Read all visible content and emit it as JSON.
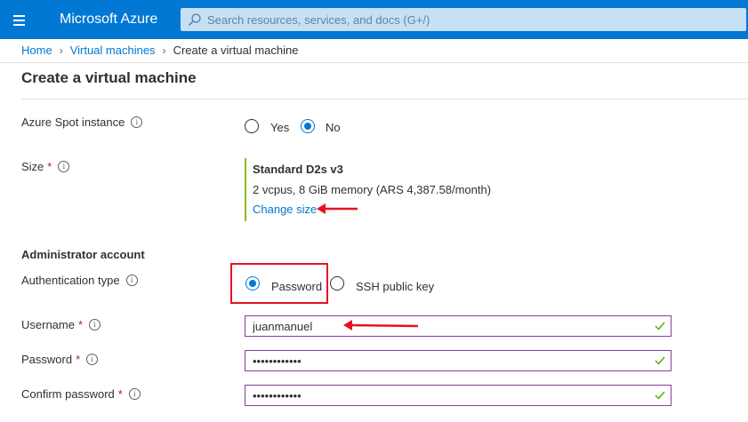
{
  "header": {
    "brand": "Microsoft Azure",
    "search_placeholder": "Search resources, services, and docs (G+/)"
  },
  "breadcrumb": {
    "items": [
      "Home",
      "Virtual machines",
      "Create a virtual machine"
    ]
  },
  "page": {
    "title": "Create a virtual machine"
  },
  "spot": {
    "label": "Azure Spot instance",
    "options": [
      "Yes",
      "No"
    ],
    "selected": "No"
  },
  "size": {
    "label": "Size",
    "name": "Standard D2s v3",
    "description": "2 vcpus, 8 GiB memory (ARS 4,387.58/month)",
    "change_link": "Change size"
  },
  "admin": {
    "heading": "Administrator account",
    "auth_label": "Authentication type",
    "auth_options": [
      "Password",
      "SSH public key"
    ],
    "auth_selected": "Password",
    "username_label": "Username",
    "username_value": "juanmanuel",
    "password_label": "Password",
    "password_value": "••••••••••••",
    "confirm_label": "Confirm password",
    "confirm_value": "••••••••••••"
  },
  "symbols": {
    "required": "*",
    "info": "i"
  },
  "colors": {
    "accent": "#0078d4",
    "header_bg": "#0078d4",
    "valid_check": "#57a300",
    "annotation": "#e81123"
  }
}
